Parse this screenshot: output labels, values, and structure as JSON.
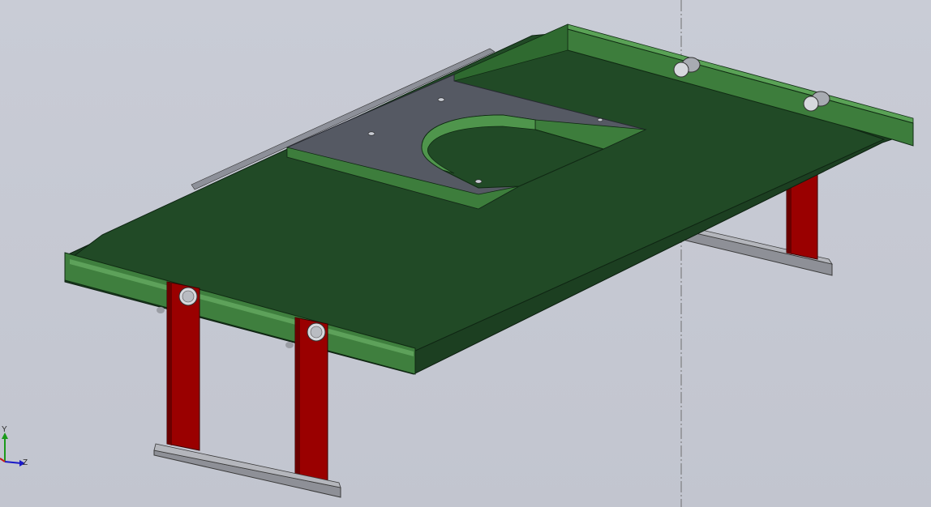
{
  "viewport": {
    "background": "#c7cad4",
    "model": "table-frame-assembly",
    "colors": {
      "top_plate": "#1f4423",
      "edge": "#3d7a3c",
      "plate_metal": "#555963",
      "legs": "#9a0000",
      "rails": "#9a9ca3"
    }
  },
  "triad": {
    "x_label": "",
    "y_label": "Y",
    "z_label": "Z",
    "y_color": "#1a9a1a",
    "z_color": "#1a1ac8",
    "x_color": "#c81a1a"
  },
  "axis_line": {
    "style": "dash-dot",
    "color": "#707070"
  }
}
